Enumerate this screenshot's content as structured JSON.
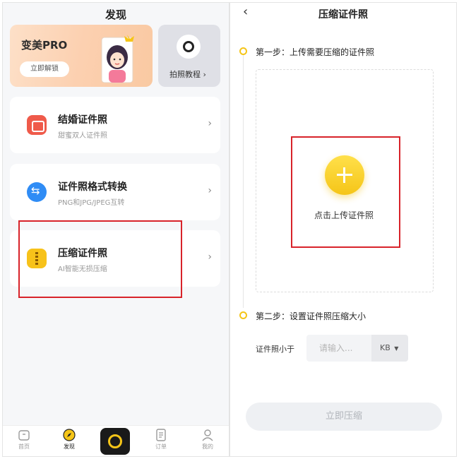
{
  "left": {
    "title": "发现",
    "pro_card": {
      "title": "变美PRO",
      "button": "立即解锁"
    },
    "tutorial": {
      "label": "拍照教程 ›",
      "icon": "lens-icon"
    },
    "features": [
      {
        "title": "结婚证件照",
        "subtitle": "甜蜜双人证件照",
        "icon": "marriage-photo-icon"
      },
      {
        "title": "证件照格式转换",
        "subtitle": "PNG和JPG/JPEG互转",
        "icon": "format-convert-icon"
      },
      {
        "title": "压缩证件照",
        "subtitle": "AI智能无损压缩",
        "icon": "zip-compress-icon"
      }
    ],
    "chevron": "›",
    "tabbar": {
      "home": "首页",
      "discover": "发现",
      "orders": "订单",
      "mine": "我的"
    }
  },
  "right": {
    "title": "压缩证件照",
    "back": "‹",
    "step1": "第一步：上传需要压缩的证件照",
    "upload_label": "点击上传证件照",
    "step2": "第二步：设置证件照压缩大小",
    "size_label": "证件照小于",
    "size_placeholder": "请输入...",
    "unit": "KB",
    "unit_caret": "▼",
    "submit": "立即压缩"
  },
  "colors": {
    "accent_yellow": "#f5c518",
    "highlight_red": "#d8232a"
  }
}
